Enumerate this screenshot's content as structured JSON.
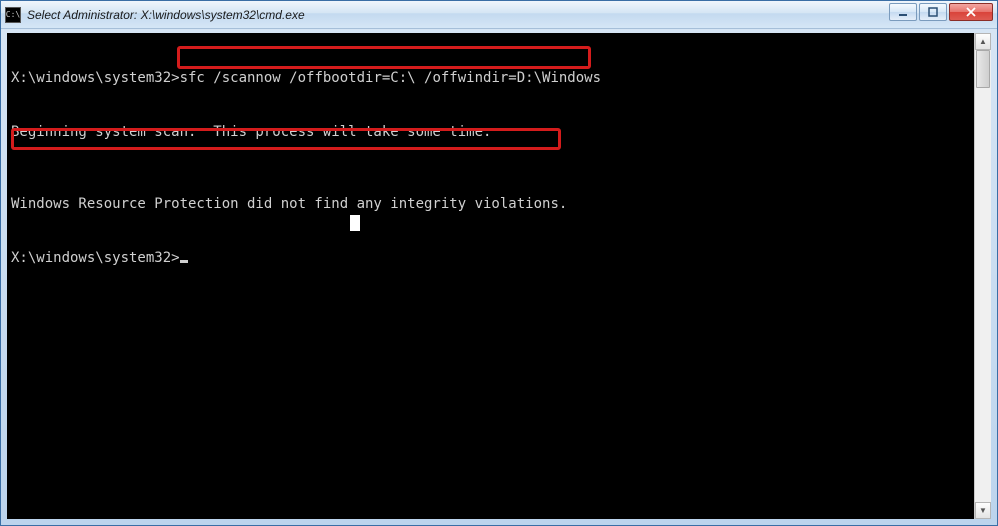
{
  "window": {
    "title": "Select Administrator: X:\\windows\\system32\\cmd.exe",
    "icon_label": "C:\\"
  },
  "terminal": {
    "prompt1": "X:\\windows\\system32>",
    "command": "sfc /scannow /offbootdir=C:\\ /offwindir=D:\\Windows",
    "line_begin": "Beginning system scan.  This process will take some time.",
    "line_result": "Windows Resource Protection did not find any integrity violations.",
    "prompt2": "X:\\windows\\system32>"
  },
  "controls": {
    "minimize": "minimize",
    "maximize": "maximize",
    "close": "close"
  },
  "scrollbar": {
    "up": "▲",
    "down": "▼"
  }
}
